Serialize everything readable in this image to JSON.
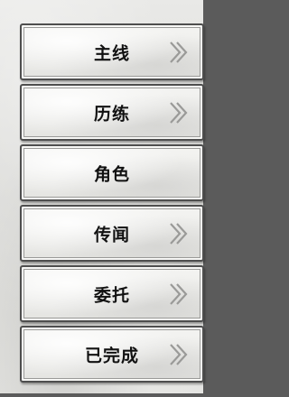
{
  "menu": {
    "items": [
      {
        "label": "主线",
        "has_arrow": true
      },
      {
        "label": "历练",
        "has_arrow": true
      },
      {
        "label": "角色",
        "has_arrow": false
      },
      {
        "label": "传闻",
        "has_arrow": true
      },
      {
        "label": "委托",
        "has_arrow": true
      },
      {
        "label": "已完成",
        "has_arrow": true
      }
    ],
    "arrow_icon": "double-chevron-right-icon"
  },
  "colors": {
    "text": "#111111",
    "button_border": "#4e4e4e",
    "panel_background": "#e3e3e0",
    "outer_background": "#5b5b5b",
    "arrow": "#9a9a98"
  }
}
